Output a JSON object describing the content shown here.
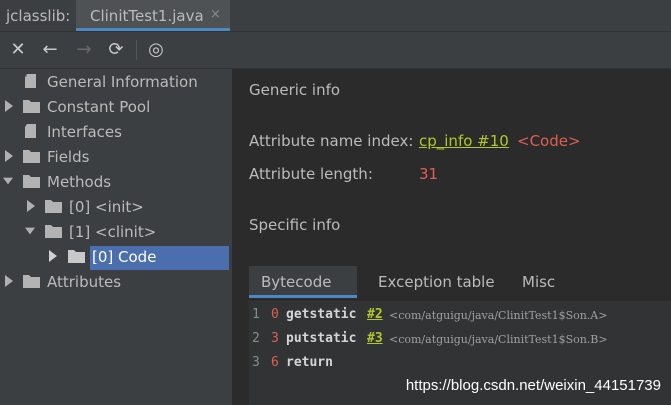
{
  "window": {
    "app_title": "jclasslib:"
  },
  "tab": {
    "label": "ClinitTest1.java",
    "close_glyph": "×"
  },
  "toolbar": {
    "close_glyph": "✕",
    "back_glyph": "←",
    "forward_glyph": "→",
    "refresh_glyph": "⟳",
    "browser_glyph": "◎"
  },
  "tree": {
    "items": [
      {
        "label": "General Information"
      },
      {
        "label": "Constant Pool"
      },
      {
        "label": "Interfaces"
      },
      {
        "label": "Fields"
      },
      {
        "label": "Methods"
      },
      {
        "label": "[0] <init>"
      },
      {
        "label": "[1] <clinit>"
      },
      {
        "label": "[0] Code"
      },
      {
        "label": "Attributes"
      }
    ]
  },
  "generic": {
    "title": "Generic info",
    "name_index_label": "Attribute name index:",
    "name_index_link": "cp_info #10",
    "name_index_value": "<Code>",
    "length_label": "Attribute length:",
    "length_value": "31"
  },
  "specific": {
    "title": "Specific info"
  },
  "subtabs": {
    "bytecode": "Bytecode",
    "exception_table": "Exception table",
    "misc": "Misc"
  },
  "bytecode": [
    {
      "line": "1",
      "offset": "0",
      "op": "getstatic",
      "ref": "#2",
      "comment": "<com/atguigu/java/ClinitTest1$Son.A>"
    },
    {
      "line": "2",
      "offset": "3",
      "op": "putstatic",
      "ref": "#3",
      "comment": "<com/atguigu/java/ClinitTest1$Son.B>"
    },
    {
      "line": "3",
      "offset": "6",
      "op": "return",
      "ref": "",
      "comment": ""
    }
  ],
  "watermark": "https://blog.csdn.net/weixin_44151739",
  "colors": {
    "panel_bg": "#3c3f41",
    "editor_bg": "#2b2b2b",
    "selection": "#4b6eaf",
    "accent": "#4a88c7",
    "link": "#b2c82a",
    "red": "#e05e53"
  }
}
